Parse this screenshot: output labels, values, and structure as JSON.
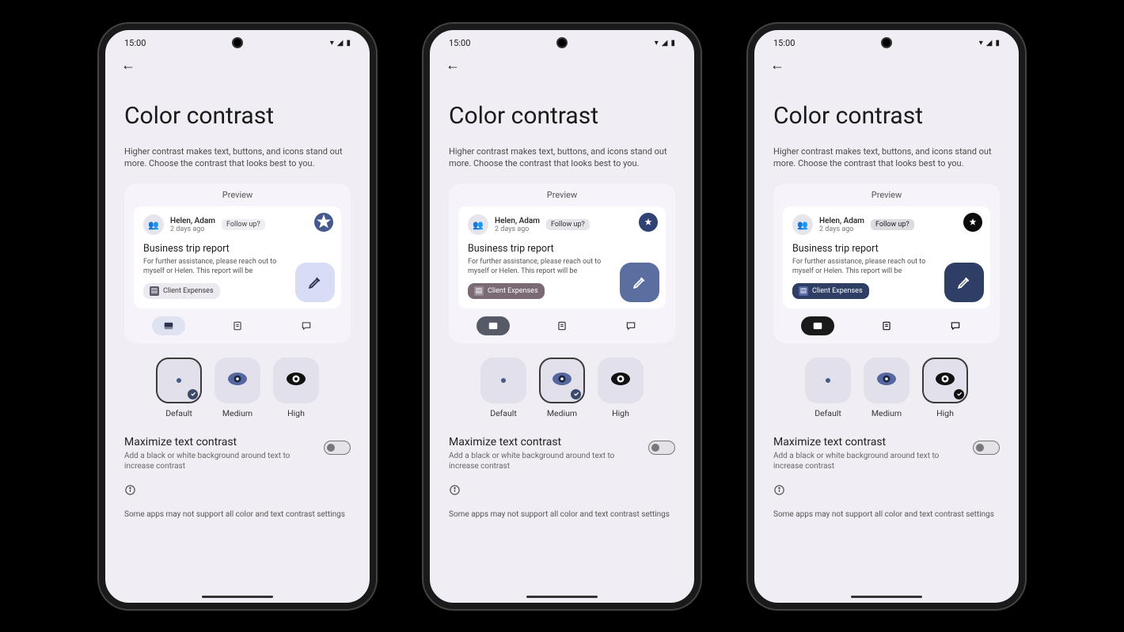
{
  "status": {
    "time": "15:00"
  },
  "page": {
    "title": "Color contrast",
    "description": "Higher contrast makes text, buttons, and icons stand out more. Choose the contrast that looks best to you."
  },
  "preview": {
    "label": "Preview",
    "from": "Helen, Adam",
    "ago": "2 days ago",
    "followup": "Follow up?",
    "subject": "Business trip report",
    "body": "For further assistance, please reach out to myself or Helen. This report will be",
    "attachment": "Client Expenses"
  },
  "levels": {
    "default": "Default",
    "medium": "Medium",
    "high": "High"
  },
  "maximize": {
    "title": "Maximize text contrast",
    "desc": "Add a black or white background around text to increase contrast"
  },
  "footnote": "Some apps may not support all color and text contrast settings",
  "variants": [
    {
      "selected": "default",
      "star_bg": "#475a8f",
      "star_fg": "#ffffff",
      "fab_bg": "#d8dcf4",
      "fab_fg": "#2b3550",
      "chip_bg": "#ece9f1",
      "chip_fg": "#3a3a3a",
      "chip_ico_bg": "#5a5a6a",
      "tab_sel_bg": "#dfe2f0",
      "tab_sel_fg": "#2b3550",
      "follow_bg": "#edeef2",
      "follow_fg": "#444"
    },
    {
      "selected": "medium",
      "star_bg": "#2f4273",
      "star_fg": "#ffffff",
      "fab_bg": "#5a6ea0",
      "fab_fg": "#ffffff",
      "chip_bg": "#7a6a75",
      "chip_fg": "#ffffff",
      "chip_ico_bg": "#9a8c96",
      "tab_sel_bg": "#555a66",
      "tab_sel_fg": "#ffffff",
      "follow_bg": "#e6e3ea",
      "follow_fg": "#333"
    },
    {
      "selected": "high",
      "star_bg": "#0b0b0b",
      "star_fg": "#ffffff",
      "fab_bg": "#2e3e64",
      "fab_fg": "#ffffff",
      "chip_bg": "#2e3e64",
      "chip_fg": "#ffffff",
      "chip_ico_bg": "#5565a0",
      "tab_sel_bg": "#1a1a1a",
      "tab_sel_fg": "#ffffff",
      "follow_bg": "#dddbe2",
      "follow_fg": "#222"
    }
  ]
}
